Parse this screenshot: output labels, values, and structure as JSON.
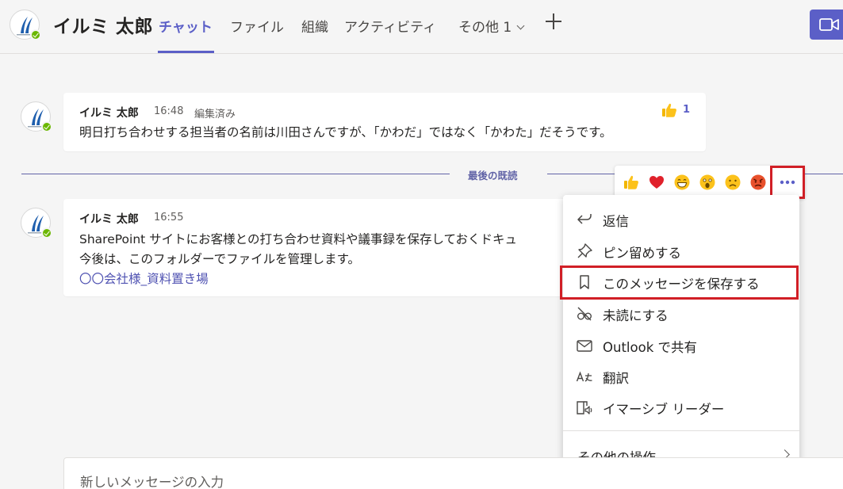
{
  "header": {
    "name": "イルミ 太郎",
    "tabs": [
      {
        "label": "チャット"
      },
      {
        "label": "ファイル"
      },
      {
        "label": "組織"
      },
      {
        "label": "アクティビティ"
      },
      {
        "label": "その他 1"
      }
    ],
    "add_tab_icon": "plus-icon",
    "video_icon": "video-camera-icon",
    "accent_color": "#5b5fc7"
  },
  "messages": [
    {
      "author": "イルミ 太郎",
      "time": "16:48",
      "status": "編集済み",
      "lines": [
        "明日打ち合わせする担当者の名前は川田さんですが、「かわだ」ではなく「かわた」だそうです。"
      ],
      "reaction": {
        "icon": "thumbs-up-icon",
        "count": "1"
      }
    },
    {
      "author": "イルミ 太郎",
      "time": "16:55",
      "lines": [
        "SharePoint サイトにお客様との打ち合わせ資料や議事録を保存しておくドキュ",
        "今後は、このフォルダーでファイルを管理します。"
      ],
      "link": "〇〇会社様_資料置き場"
    }
  ],
  "divider": {
    "label": "最後の既読"
  },
  "reactions_bar": [
    "thumbs-up-icon",
    "heart-icon",
    "laugh-icon",
    "surprised-icon",
    "sad-icon",
    "angry-icon"
  ],
  "more_options_icon": "more-options-icon",
  "context_menu": {
    "items": [
      {
        "label": "返信",
        "icon": "reply-icon"
      },
      {
        "label": "ピン留めする",
        "icon": "pin-icon"
      },
      {
        "label": "このメッセージを保存する",
        "icon": "bookmark-icon"
      },
      {
        "label": "未読にする",
        "icon": "unread-icon"
      },
      {
        "label": "Outlook で共有",
        "icon": "mail-icon"
      },
      {
        "label": "翻訳",
        "icon": "translate-icon"
      },
      {
        "label": "イマーシブ リーダー",
        "icon": "immersive-reader-icon"
      }
    ],
    "more_actions": "その他の操作"
  },
  "compose": {
    "placeholder": "新しいメッセージの入力"
  },
  "highlight_color": "#d11f26"
}
